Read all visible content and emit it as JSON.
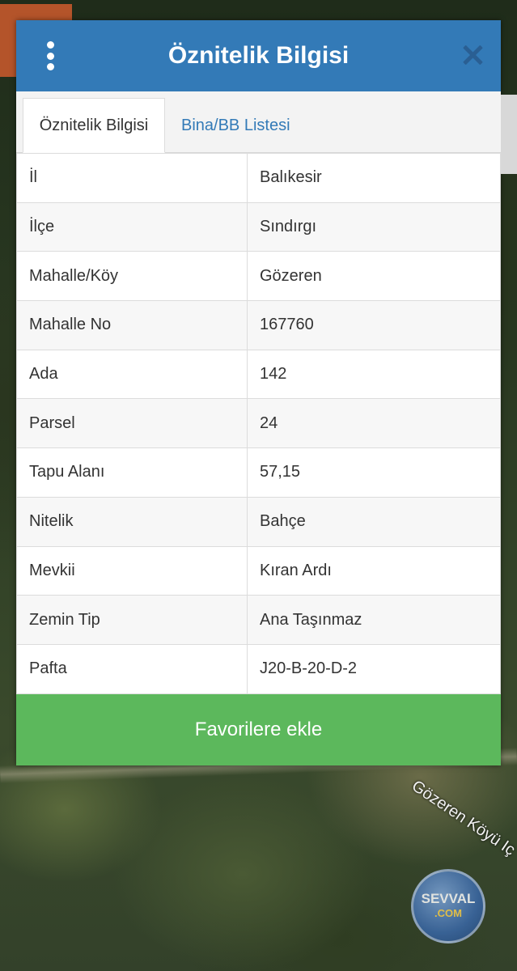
{
  "dialog": {
    "title": "Öznitelik Bilgisi",
    "tabs": [
      {
        "label": "Öznitelik Bilgisi",
        "active": true
      },
      {
        "label": "Bina/BB Listesi",
        "active": false
      }
    ],
    "rows": [
      {
        "key": "İl",
        "value": "Balıkesir"
      },
      {
        "key": "İlçe",
        "value": "Sındırgı"
      },
      {
        "key": "Mahalle/Köy",
        "value": "Gözeren"
      },
      {
        "key": "Mahalle No",
        "value": "167760"
      },
      {
        "key": "Ada",
        "value": "142"
      },
      {
        "key": "Parsel",
        "value": "24"
      },
      {
        "key": "Tapu Alanı",
        "value": "57,15"
      },
      {
        "key": "Nitelik",
        "value": "Bahçe"
      },
      {
        "key": "Mevkii",
        "value": "Kıran Ardı"
      },
      {
        "key": "Zemin Tip",
        "value": "Ana Taşınmaz"
      },
      {
        "key": "Pafta",
        "value": "J20-B-20-D-2"
      }
    ],
    "favorite_button": "Favorilere ekle"
  },
  "map": {
    "road_label": "Gözeren Köyü Iç"
  },
  "watermark": {
    "line1": "SEVVAL",
    "line2": ".COM"
  },
  "colors": {
    "header": "#337ab7",
    "button": "#5cb85c",
    "tab_link": "#337ab7"
  }
}
